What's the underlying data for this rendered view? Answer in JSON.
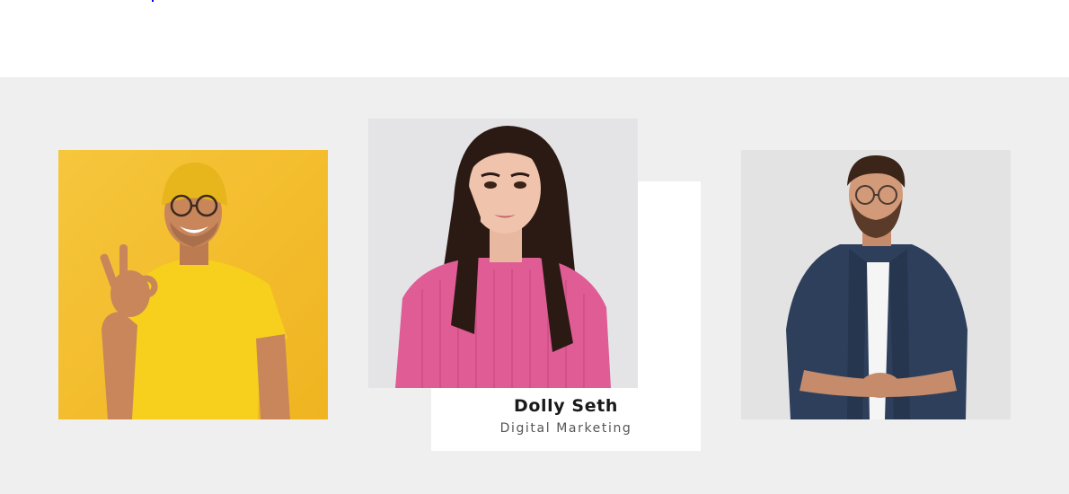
{
  "team": {
    "members": [
      {
        "photo_desc": "smiling-man-yellow-beanie"
      },
      {
        "name": "Dolly Seth",
        "role": "Digital Marketing",
        "photo_desc": "woman-pink-sweater"
      },
      {
        "photo_desc": "man-navy-shirt"
      }
    ]
  },
  "colors": {
    "section_bg": "#efefef",
    "card_bg": "#ffffff",
    "name_text": "#1a1a1a",
    "role_text": "#555555"
  }
}
